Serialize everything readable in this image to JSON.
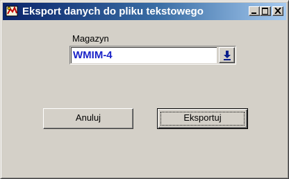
{
  "window": {
    "title": "Eksport danych do pliku tekstowego",
    "app_icon": "dbase-app-icon",
    "controls": {
      "minimize_icon": "minimize-icon",
      "maximize_icon": "maximize-icon",
      "close_icon": "close-icon"
    }
  },
  "form": {
    "warehouse_label": "Magazyn",
    "warehouse_value": "WMIM-4",
    "dropdown_icon": "arrow-down-icon",
    "value_color": "#1a23c8"
  },
  "buttons": {
    "cancel_label": "Anuluj",
    "export_label": "Eksportuj"
  }
}
